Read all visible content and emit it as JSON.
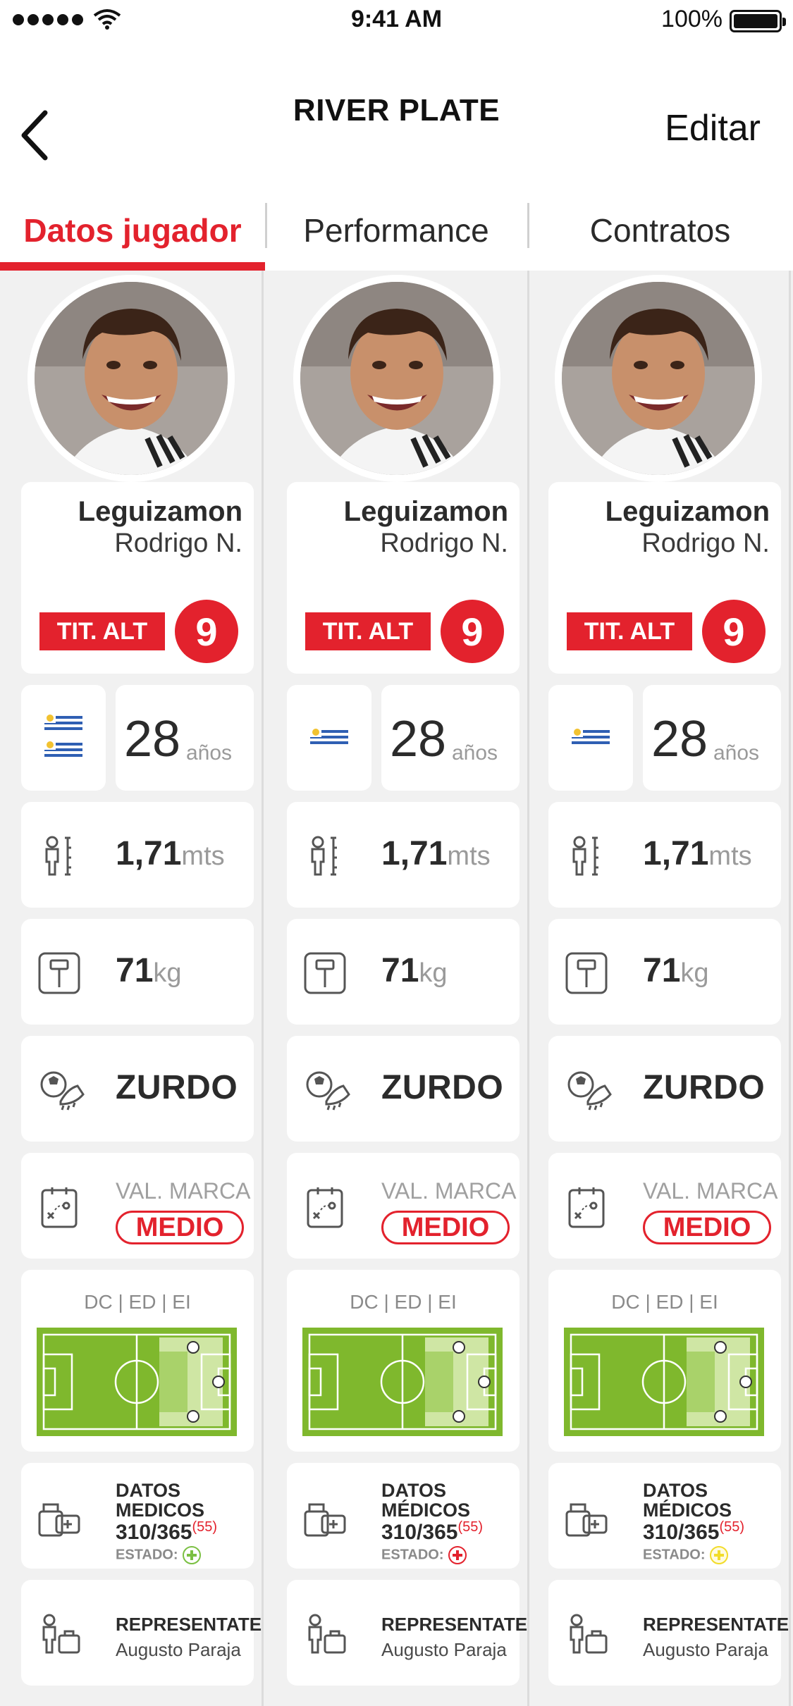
{
  "status_bar": {
    "time": "9:41 AM",
    "battery": "100%"
  },
  "nav": {
    "title": "RIVER PLATE",
    "edit_label": "Editar"
  },
  "tabs": [
    {
      "label": "Datos jugador",
      "active": true
    },
    {
      "label": "Performance",
      "active": false
    },
    {
      "label": "Contratos",
      "active": false
    }
  ],
  "players": [
    {
      "last_name": "Leguizamon",
      "first_name": "Rodrigo N.",
      "role_badge": "TIT. ALT",
      "number": "9",
      "flag": "uruguay-flag-double",
      "age": "28",
      "age_unit": "años",
      "height": "1,71",
      "height_unit": "mts",
      "weight": "71",
      "weight_unit": "kg",
      "foot": "ZURDO",
      "val_marca_label": "VAL. MARCA",
      "val_marca": "MEDIO",
      "positions": "DC | ED | EI",
      "med_line1": "DATOS",
      "med_line2": "MEDICOS",
      "med_days": "310/365",
      "med_sup": "(55)",
      "estado_label": "ESTADO:",
      "estado_color": "#7bc043",
      "estado_icon": "plus-green-icon",
      "rep_label": "REPRESENTATE",
      "rep_name": "Augusto Paraja"
    },
    {
      "last_name": "Leguizamon",
      "first_name": "Rodrigo N.",
      "role_badge": "TIT. ALT",
      "number": "9",
      "flag": "uruguay-flag",
      "age": "28",
      "age_unit": "años",
      "height": "1,71",
      "height_unit": "mts",
      "weight": "71",
      "weight_unit": "kg",
      "foot": "ZURDO",
      "val_marca_label": "VAL. MARCA",
      "val_marca": "MEDIO",
      "positions": "DC | ED | EI",
      "med_line1": "DATOS",
      "med_line2": "MÉDICOS",
      "med_days": "310/365",
      "med_sup": "(55)",
      "estado_label": "ESTADO:",
      "estado_color": "#e3222d",
      "estado_icon": "plus-red-icon",
      "rep_label": "REPRESENTATE",
      "rep_name": "Augusto Paraja"
    },
    {
      "last_name": "Leguizamon",
      "first_name": "Rodrigo N.",
      "role_badge": "TIT. ALT",
      "number": "9",
      "flag": "uruguay-flag",
      "age": "28",
      "age_unit": "años",
      "height": "1,71",
      "height_unit": "mts",
      "weight": "71",
      "weight_unit": "kg",
      "foot": "ZURDO",
      "val_marca_label": "VAL. MARCA",
      "val_marca": "MEDIO",
      "positions": "DC | ED | EI",
      "med_line1": "DATOS",
      "med_line2": "MÉDICOS",
      "med_days": "310/365",
      "med_sup": "(55)",
      "estado_label": "ESTADO:",
      "estado_color": "#f2dc2b",
      "estado_icon": "plus-yellow-icon",
      "rep_label": "REPRESENTATE",
      "rep_name": "Augusto Paraja"
    }
  ],
  "colors": {
    "accent": "#e3222d",
    "pitch": "#7fb82d"
  }
}
